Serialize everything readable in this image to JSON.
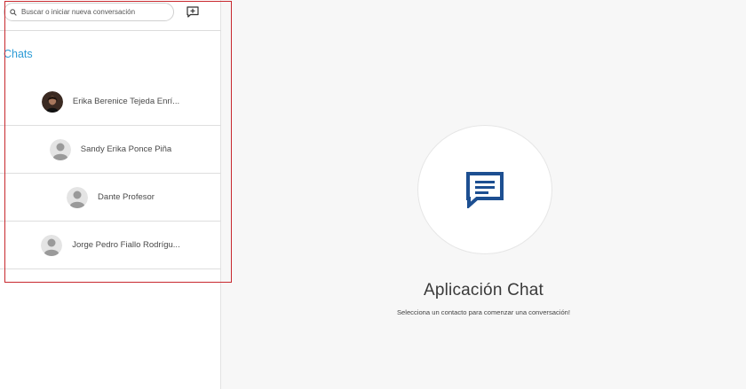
{
  "search": {
    "placeholder": "Buscar o iniciar nueva conversación"
  },
  "sidebar": {
    "heading": "Chats",
    "contacts": [
      {
        "name": "Erika Berenice Tejeda Enrí...",
        "avatar": "photo"
      },
      {
        "name": "Sandy Erika Ponce Piña",
        "avatar": "default-user"
      },
      {
        "name": "Dante Profesor",
        "avatar": "default-user"
      },
      {
        "name": "Jorge Pedro Fiallo Rodrígu...",
        "avatar": "default-user"
      }
    ]
  },
  "main": {
    "title": "Aplicación Chat",
    "subtitle": "Selecciona un contacto para comenzar una conversación!",
    "icon": "chat-bubble-icon"
  },
  "colors": {
    "accent": "#2c9bd6",
    "chat_icon": "#1d4f91",
    "highlight": "#c8282e"
  },
  "icons": {
    "search": "search-icon",
    "new_chat": "new-chat-icon"
  }
}
